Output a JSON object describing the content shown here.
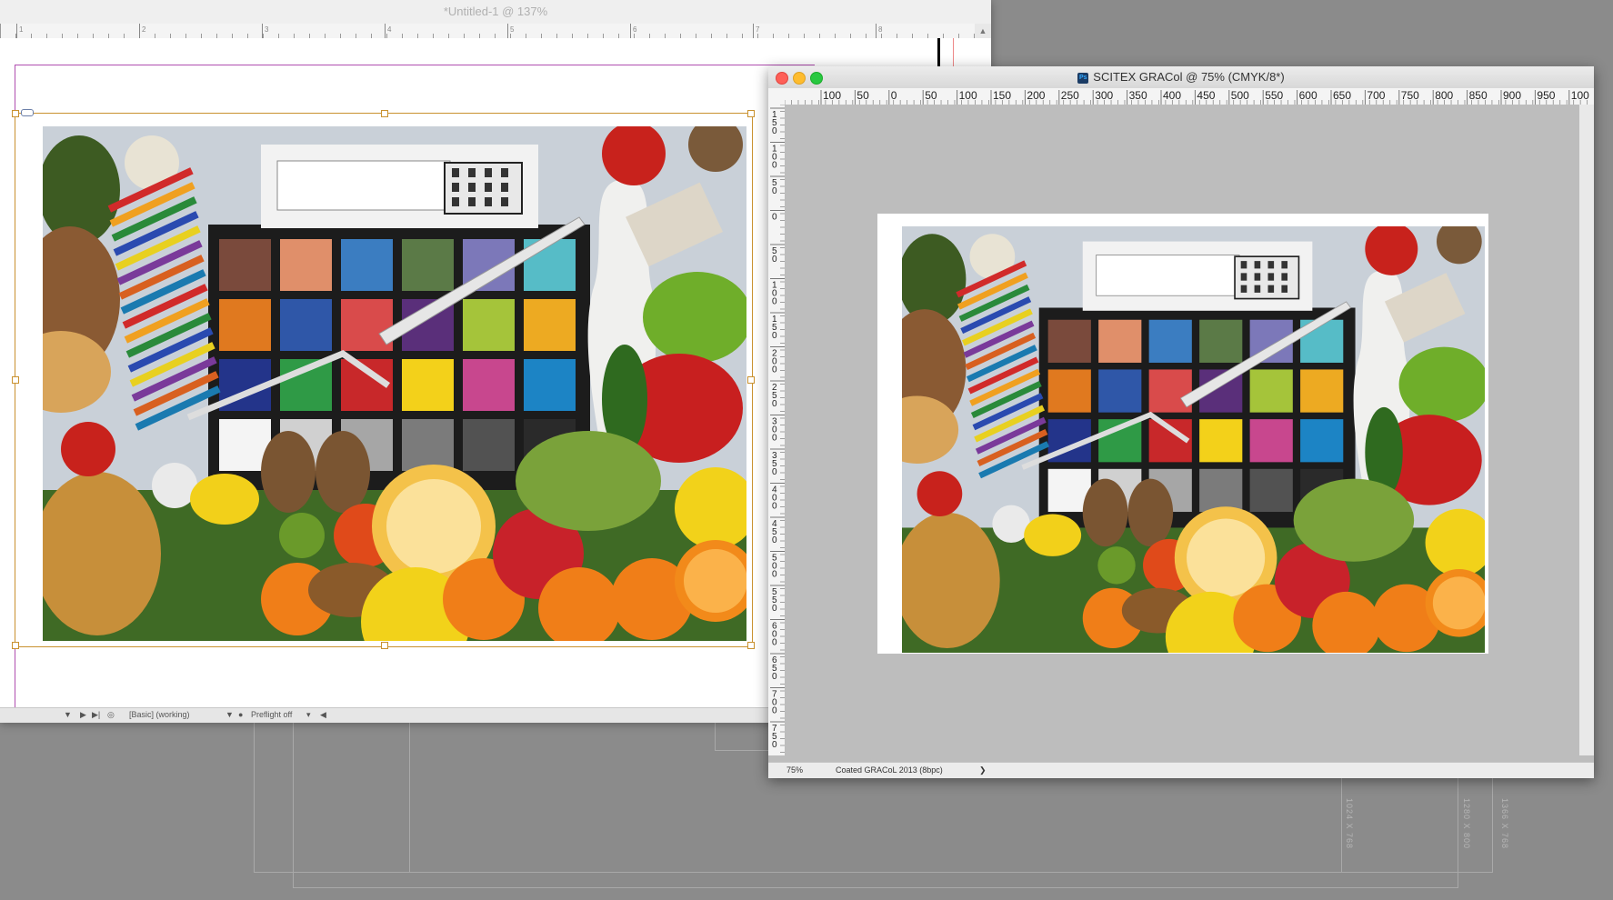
{
  "background_guides": {
    "labels": [
      "1024 X 768",
      "1280 X 800",
      "1366 X 768"
    ]
  },
  "indesign": {
    "title": "*Untitled-1 @ 137%",
    "ruler_numbers": [
      "1",
      "2",
      "3",
      "4",
      "5",
      "6",
      "7",
      "8",
      "0"
    ],
    "status": {
      "page_nav_first": "◀",
      "page_nav_next": "▶",
      "page_nav_last": "▶|",
      "workspace": "[Basic] (working)",
      "preflight": "Preflight off"
    }
  },
  "photoshop": {
    "title": "SCITEX GRACol @ 75% (CMYK/8*)",
    "app_icon": "Ps",
    "hruler_labels": [
      "100",
      "50",
      "0",
      "50",
      "100",
      "150",
      "200",
      "250",
      "300",
      "350",
      "400",
      "450",
      "500",
      "550",
      "600",
      "650",
      "700",
      "750",
      "800",
      "850",
      "900",
      "950",
      "100"
    ],
    "vruler_labels": [
      "1\n5\n0",
      "1\n0\n0",
      "5\n0",
      "0",
      "5\n0",
      "1\n0\n0",
      "1\n5\n0",
      "2\n0\n0",
      "2\n5\n0",
      "3\n0\n0",
      "3\n5\n0",
      "4\n0\n0",
      "4\n5\n0",
      "5\n0\n0",
      "5\n5\n0",
      "6\n0\n0",
      "6\n5\n0",
      "7\n0\n0",
      "7\n5\n0"
    ],
    "status": {
      "zoom": "75%",
      "profile": "Coated GRACoL 2013 (8bpc)",
      "arrow": "❯"
    }
  },
  "colorchecker_swatches": [
    "#7a4a3c",
    "#e08f6a",
    "#3b7dc1",
    "#5b7a47",
    "#7c78b9",
    "#56bcc7",
    "#e0791f",
    "#2f57a8",
    "#d94b4b",
    "#5a2f7a",
    "#a5c43a",
    "#edaa22",
    "#23348a",
    "#2f9a46",
    "#c8282a",
    "#f3d11a",
    "#c8478e",
    "#1c84c5",
    "#f4f4f4",
    "#d0d0d0",
    "#a6a6a6",
    "#7b7b7b",
    "#525252",
    "#2a2a2a"
  ]
}
